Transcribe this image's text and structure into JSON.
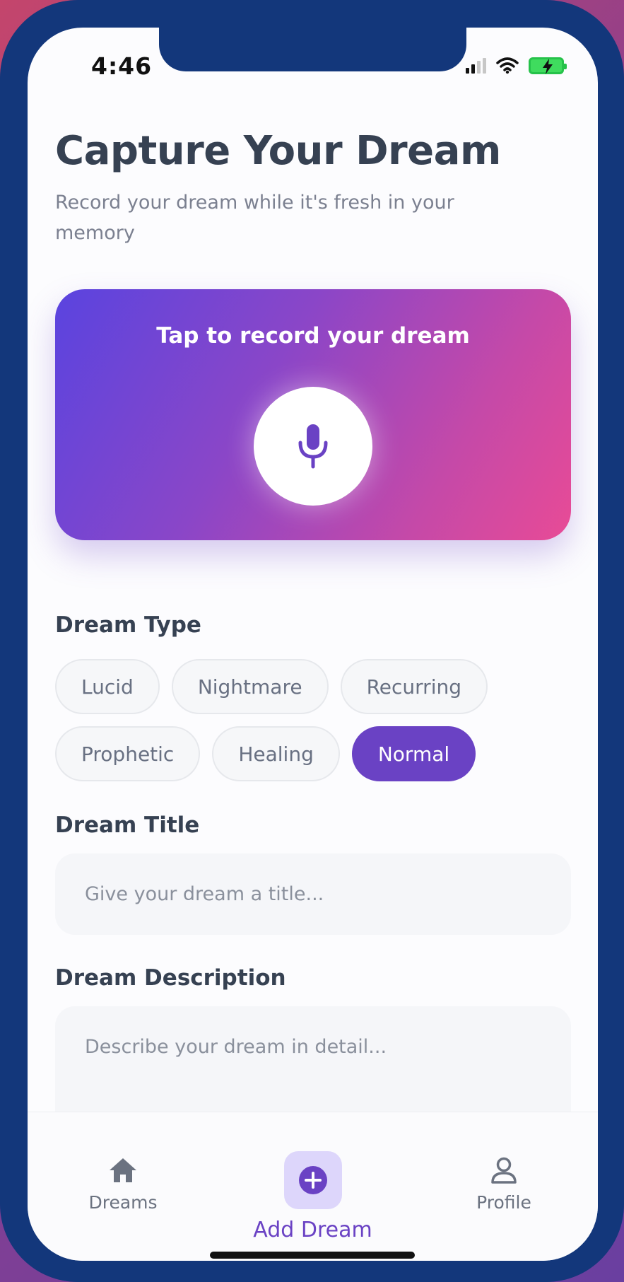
{
  "status_bar": {
    "time": "4:46"
  },
  "header": {
    "title": "Capture Your Dream",
    "subtitle": "Record your dream while it's fresh in your memory"
  },
  "recorder": {
    "label": "Tap to record your dream",
    "icon": "microphone-icon"
  },
  "dream_type": {
    "label": "Dream Type",
    "options": [
      "Lucid",
      "Nightmare",
      "Recurring",
      "Prophetic",
      "Healing",
      "Normal"
    ],
    "selected": "Normal"
  },
  "dream_title": {
    "label": "Dream Title",
    "placeholder": "Give your dream a title..."
  },
  "dream_description": {
    "label": "Dream Description",
    "placeholder": "Describe your dream in detail..."
  },
  "bottom_nav": {
    "items": [
      {
        "label": "Dreams",
        "icon": "home-icon"
      },
      {
        "label": "Add Dream",
        "icon": "plus-circle-icon",
        "active": true
      },
      {
        "label": "Profile",
        "icon": "user-icon"
      }
    ]
  },
  "colors": {
    "accent": "#6a42c4",
    "frame": "#13377b",
    "gradient_start": "#5a44df",
    "gradient_end": "#e84b96"
  }
}
